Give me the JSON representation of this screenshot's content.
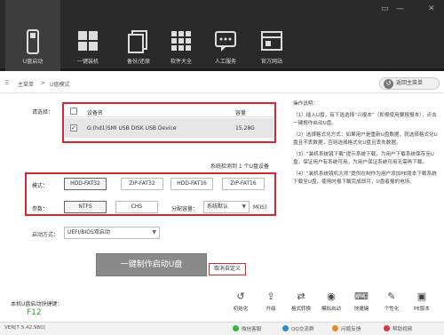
{
  "window": {
    "controls": [
      "▭",
      "—",
      "✕"
    ]
  },
  "nav": [
    {
      "label": "U盘启动",
      "icon": "usb-drive-icon",
      "active": true
    },
    {
      "label": "一键装机",
      "icon": "windows-install-icon"
    },
    {
      "label": "备份/还原",
      "icon": "backup-restore-icon"
    },
    {
      "label": "软件大全",
      "icon": "software-grid-icon"
    },
    {
      "label": "人工服务",
      "icon": "chat-service-icon"
    },
    {
      "label": "官方网站",
      "icon": "website-icon"
    }
  ],
  "breadcrumb": {
    "home": "主菜单",
    "sep": ">",
    "current": "U盘模式"
  },
  "back_button": "返回主菜单",
  "device": {
    "select_label": "请选择：",
    "col_name": "设备名",
    "col_capacity": "容量",
    "row_name": "G:(hd1)SMI USB DISK USB Device",
    "row_capacity": "15.28G",
    "checked": true,
    "detected_text": "系统检测到 1 个U盘设备"
  },
  "mode": {
    "label": "模式：",
    "options": [
      "HDD-FAT32",
      "ZIP-FAT32",
      "HDD-FAT16",
      "ZIP-FAT16"
    ]
  },
  "params": {
    "label": "参数：",
    "fs_options": [
      "NTFS",
      "CHS"
    ],
    "alloc_label": "分配容量：",
    "alloc_value": "系统默认",
    "unit": "M(IS)"
  },
  "boot": {
    "label": "启动方式：",
    "value": "UEFI/BIOS双启动"
  },
  "actions": {
    "make_button": "一键制作启动U盘",
    "cancel_button": "取消自定义"
  },
  "hotkey": {
    "label": "本机U盘启动快捷键：",
    "key": "F12"
  },
  "instructions": {
    "title": "操作说明：",
    "items": [
      "（1）插入U盘，有下选选择“兴报本”（即报使用要报报本），点击一键报作启动U盘。",
      "（2）选择格式化方式：如果用户是重新U盘数据，就选择格式化U盘且不丢数据，否则选择格式化U盘且丢失数据。",
      "（3）“装机系统镜下载”提示系统下载，为用户下载系统保存至U盘，保证用户有系统可用。为用户保证系统可用无需再下载。",
      "（4）“装机系统镜机大师”提供在制作为用户添加PE版本下载系统下载至U盘，使用时报下载完成即可，U盘者报的电场。"
    ]
  },
  "tools": [
    {
      "label": "初始化",
      "icon": "reset-icon"
    },
    {
      "label": "升级",
      "icon": "upgrade-icon"
    },
    {
      "label": "格式转换",
      "icon": "format-convert-icon"
    },
    {
      "label": "模拟启动",
      "icon": "eye-icon"
    },
    {
      "label": "快捷键",
      "icon": "keyboard-icon"
    },
    {
      "label": "个性化",
      "icon": "personalize-icon"
    },
    {
      "label": "PE版本",
      "icon": "pe-version-icon"
    }
  ],
  "footer": {
    "version": "VER[7.5.42.980]",
    "links": [
      "微信客服",
      "QQ交流群",
      "问题反馈",
      "帮助视频"
    ]
  },
  "colors": {
    "accent_red": "#e0242f",
    "topbar": "#2a2a2a",
    "button_gray": "#8a8a8a"
  }
}
